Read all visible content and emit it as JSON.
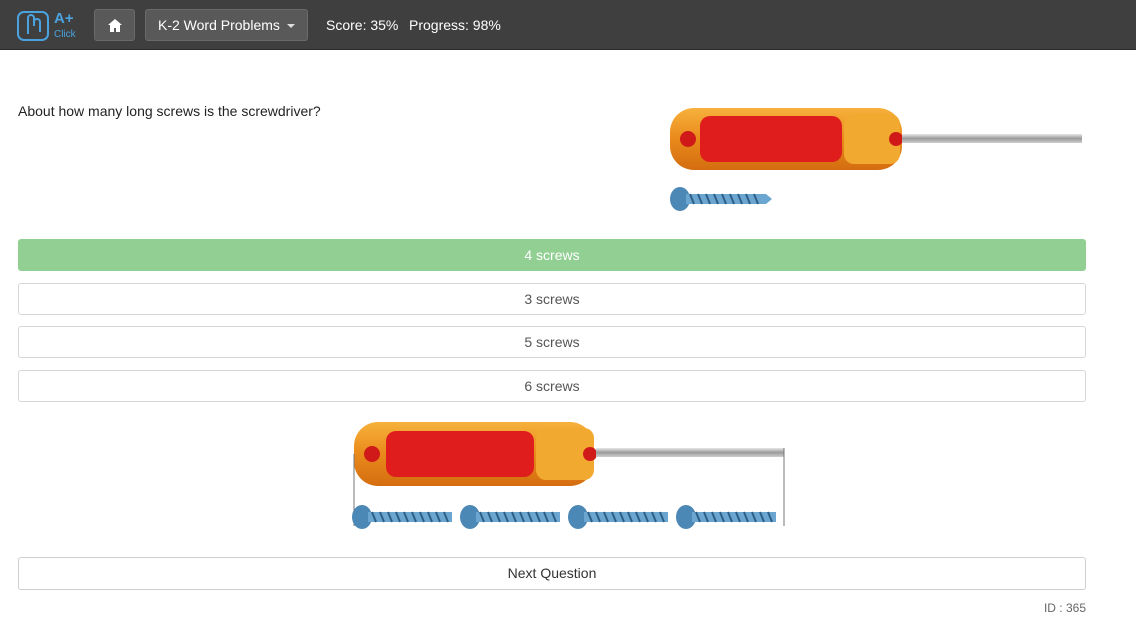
{
  "header": {
    "logo_text": "A+",
    "logo_sub": "Click",
    "topic": "K-2 Word Problems",
    "score": "Score: 35%",
    "progress": "Progress: 98%"
  },
  "question": {
    "text": "About how many long screws is the screwdriver?",
    "answers": [
      {
        "label": "4 screws",
        "state": "correct"
      },
      {
        "label": "3 screws",
        "state": "default"
      },
      {
        "label": "5 screws",
        "state": "default"
      },
      {
        "label": "6 screws",
        "state": "default"
      }
    ],
    "next_label": "Next Question",
    "id_text": "ID : 365"
  },
  "colors": {
    "topbar": "#3f3f3f",
    "correct": "#92cf93",
    "logo": "#4aa3df"
  },
  "icons": [
    "home-icon",
    "caret-down-icon",
    "logo-icon"
  ]
}
